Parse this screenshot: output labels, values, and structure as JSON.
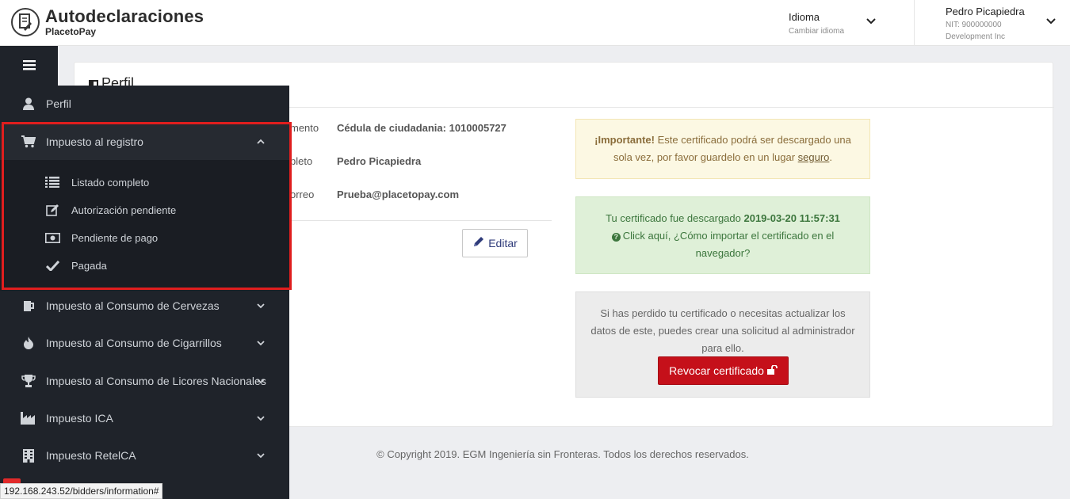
{
  "header": {
    "brand_title": "Autodeclaraciones",
    "brand_sub": "PlacetoPay",
    "language_title": "Idioma",
    "language_sub": "Cambiar idioma",
    "user_name": "Pedro Picapiedra",
    "user_nit": "NIT: 900000000",
    "user_org": "Development Inc"
  },
  "page": {
    "title": "Perfil",
    "fields": [
      {
        "label": "mento",
        "value": "Cédula de ciudadania: 1010005727"
      },
      {
        "label": "pleto",
        "value": "Pedro Picapiedra"
      },
      {
        "label": "orreo",
        "value": "Prueba@placetopay.com"
      }
    ],
    "edit_label": "Editar"
  },
  "alerts": {
    "warn_bold": "¡Importante!",
    "warn_text": " Este certificado podrá ser descargado una sola vez, por favor guardelo en un lugar ",
    "warn_link": "seguro",
    "warn_end": ".",
    "ok_text": "Tu certificado fue descargado ",
    "ok_date": "2019-03-20 11:57:31",
    "ok_link": "Click aquí, ¿Cómo importar el certificado en el navegador?",
    "gray_text": "Si has perdido tu certificado o necesitas actualizar los datos de este, puedes crear una solicitud al administrador para ello.",
    "revoke_label": "Revocar certificado"
  },
  "footer": "© Copyright 2019. EGM Ingeniería sin Fronteras. Todos los derechos reservados.",
  "sidebar": {
    "items": [
      {
        "label": "Perfil",
        "icon": "user-icon"
      },
      {
        "label": "Impuesto al registro",
        "icon": "cart-icon"
      },
      {
        "label": "Impuesto al Consumo de Cervezas",
        "icon": "beer-icon"
      },
      {
        "label": "Impuesto al Consumo de Cigarrillos",
        "icon": "fire-icon"
      },
      {
        "label": "Impuesto al Consumo de Licores Nacionales",
        "icon": "trophy-icon"
      },
      {
        "label": "Impuesto ICA",
        "icon": "industry-icon"
      },
      {
        "label": "Impuesto RetelCA",
        "icon": "building-icon"
      }
    ],
    "submenu": [
      {
        "label": "Listado completo",
        "icon": "list-icon"
      },
      {
        "label": "Autorización pendiente",
        "icon": "edit-icon"
      },
      {
        "label": "Pendiente de pago",
        "icon": "money-icon"
      },
      {
        "label": "Pagada",
        "icon": "check-icon"
      }
    ]
  },
  "status_bar": "192.168.243.52/bidders/information#",
  "colors": {
    "sidebar_bg": "#1f232a",
    "highlight": "#e01e1e",
    "revoke_btn": "#c5101a",
    "warn_bg": "#fcf8e3",
    "ok_bg": "#dff0d8"
  }
}
